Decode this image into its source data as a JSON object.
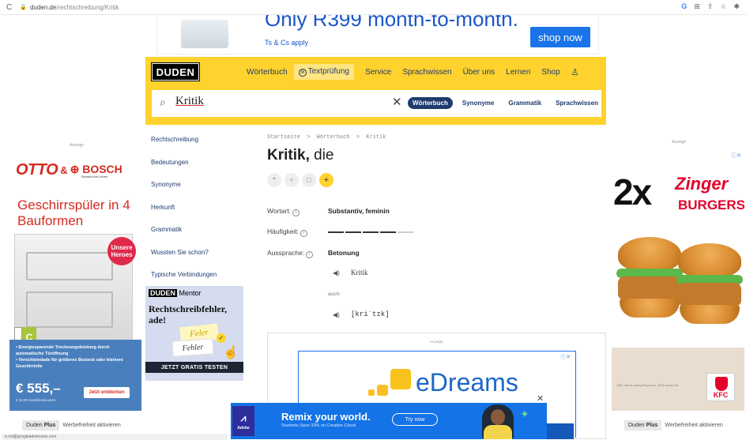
{
  "browser": {
    "reload_icon": "reload-icon",
    "url_host": "duden.de",
    "url_path": "/rechtschreibung/Kritik",
    "right_icons": [
      "google-icon",
      "translate-icon",
      "share-icon",
      "star-icon",
      "extensions-icon"
    ]
  },
  "top_ad": {
    "headline": "Only R399 month-to-month.",
    "tcs": "Ts & Cs apply",
    "shop_now": "shop now"
  },
  "header": {
    "logo": "DUDEN",
    "nav": [
      "Wörterbuch",
      "Textprüfung",
      "Service",
      "Sprachwissen",
      "Über uns",
      "Lernen",
      "Shop"
    ],
    "textpruefung_badge": "M"
  },
  "search": {
    "query": "Kritik",
    "tabs": [
      "Wörterbuch",
      "Synonyme",
      "Grammatik",
      "Sprachwissen"
    ]
  },
  "left_ad": {
    "label": "Anzeige",
    "brand1": "OTTO",
    "amp": "&",
    "brand2": "BOSCH",
    "brand2_tagline": "Technik fürs Leben",
    "title": "Geschirrspüler in 4 Bauformen",
    "badge": "Unsere Heroes",
    "energy_class": "C",
    "bullets": [
      "• Energiesparende Trocknungsleistung durch automatische Türöffnung",
      "• Verschiebelade für größeres Besteck oder kleinere Geschirrteile"
    ],
    "price": "€ 555,–",
    "price_note": "€ 34,99 Speditionskosten",
    "cta": "Jetzt entdecken"
  },
  "right_ad": {
    "label": "Anzeige",
    "twox": "2x",
    "zinger": "Zinger",
    "burgers": "BURGERS",
    "kfc": "KFC",
    "fine": "Offer valid at participating stores. While stocks last."
  },
  "werbefrei": {
    "plus_a": "Duden",
    "plus_b": "Plus",
    "text": "Werbefreiheit aktivieren"
  },
  "sidebar": {
    "links": [
      "Rechtschreibung",
      "Bedeutungen",
      "Synonyme",
      "Herkunft",
      "Grammatik",
      "Wussten Sie schon?",
      "Typische Verbindungen"
    ]
  },
  "mentor_ad": {
    "logo_a": "DUDEN",
    "logo_b": "Mentor",
    "headline": "Rechtschreibfehler, ade!",
    "card1": "Feler",
    "card2": "Fehler",
    "cta": "JETZT GRATIS TESTEN"
  },
  "entry": {
    "breadcrumb": [
      "Startseite",
      "Wörterbuch",
      "Kritik"
    ],
    "breadcrumb_sep": ">",
    "headword": "Kritik,",
    "article": "die",
    "actions": [
      "quote-icon",
      "share-icon",
      "copy-icon",
      "plus-icon"
    ],
    "wortart_label": "Wortart:",
    "wortart_value": "Substantiv, feminin",
    "haeufigkeit_label": "Häufigkeit:",
    "haeufigkeit_level": 4,
    "haeufigkeit_max": 5,
    "aussprache_label": "Aussprache:",
    "betonung": "Betonung",
    "stress_form": "Kritik",
    "auch": "auch:",
    "ipa": "[kriˈtɪk]"
  },
  "mid_ad": {
    "label": "Anzeige",
    "brand": "eDreams"
  },
  "adobe": {
    "logo": "Adobe",
    "headline": "Remix your world.",
    "subline": "Students Save 33% on Creative Cloud.",
    "cta": "Try now"
  },
  "status": {
    "url": "e.col@googleadservices.com"
  },
  "colors": {
    "duden_yellow": "#ffd22e",
    "duden_navy": "#1f3b6e",
    "otto_red": "#d52b1e",
    "kfc_red": "#e4002b",
    "edreams_blue": "#1b67c8",
    "adobe_blue": "#1473e6"
  }
}
